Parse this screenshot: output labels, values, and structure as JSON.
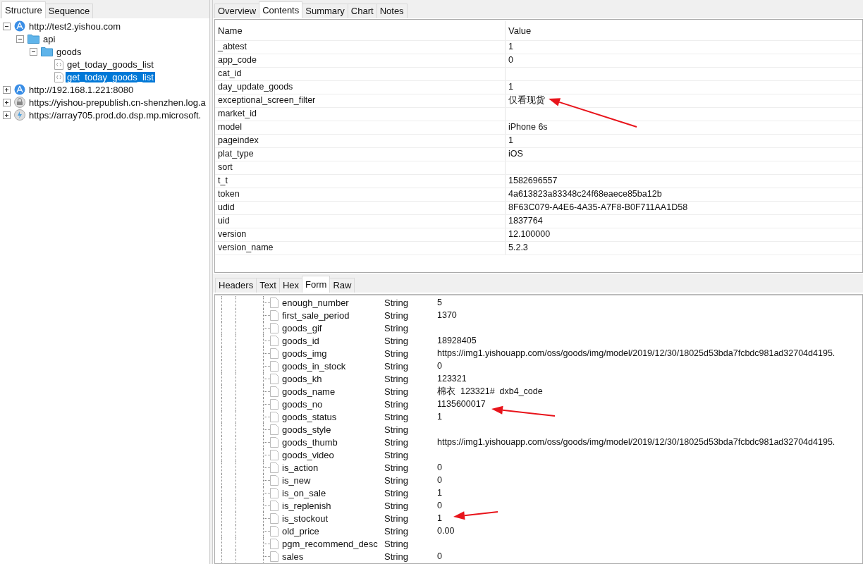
{
  "sidebar": {
    "tabs": [
      {
        "label": "Structure",
        "selected": true
      },
      {
        "label": "Sequence",
        "selected": false
      }
    ],
    "tree": [
      {
        "label": "http://test2.yishou.com",
        "kind": "host",
        "expanded": true,
        "selected": false,
        "children": [
          {
            "label": "api",
            "kind": "folder",
            "expanded": true,
            "selected": false,
            "children": [
              {
                "label": "goods",
                "kind": "folder",
                "expanded": true,
                "selected": false,
                "children": [
                  {
                    "label": "get_today_goods_list",
                    "kind": "request",
                    "selected": false
                  },
                  {
                    "label": "get_today_goods_list",
                    "kind": "request",
                    "selected": true
                  }
                ]
              }
            ]
          }
        ]
      },
      {
        "label": "http://192.168.1.221:8080",
        "kind": "host",
        "expanded": false,
        "selected": false
      },
      {
        "label": "https://yishou-prepublish.cn-shenzhen.log.a",
        "kind": "secure-host",
        "expanded": false,
        "selected": false
      },
      {
        "label": "https://array705.prod.do.dsp.mp.microsoft.",
        "kind": "service-host",
        "expanded": false,
        "selected": false
      }
    ]
  },
  "main": {
    "tabs": [
      {
        "label": "Overview",
        "selected": false
      },
      {
        "label": "Contents",
        "selected": true
      },
      {
        "label": "Summary",
        "selected": false
      },
      {
        "label": "Chart",
        "selected": false
      },
      {
        "label": "Notes",
        "selected": false
      }
    ],
    "table": {
      "columns": [
        "Name",
        "Value"
      ],
      "rows": [
        [
          "_abtest",
          "1"
        ],
        [
          "app_code",
          "0"
        ],
        [
          "cat_id",
          ""
        ],
        [
          "day_update_goods",
          "1"
        ],
        [
          "exceptional_screen_filter",
          "仅看现货"
        ],
        [
          "market_id",
          ""
        ],
        [
          "model",
          "iPhone 6s"
        ],
        [
          "pageindex",
          "1"
        ],
        [
          "plat_type",
          "iOS"
        ],
        [
          "sort",
          ""
        ],
        [
          "t_t",
          "1582696557"
        ],
        [
          "token",
          "4a613823a83348c24f68eaece85ba12b"
        ],
        [
          "udid",
          "8F63C079-A4E6-4A35-A7F8-B0F711AA1D58"
        ],
        [
          "uid",
          "1837764"
        ],
        [
          "version",
          "12.100000"
        ],
        [
          "version_name",
          "5.2.3"
        ]
      ]
    },
    "body_tabs": [
      {
        "label": "Headers",
        "selected": false
      },
      {
        "label": "Text",
        "selected": false
      },
      {
        "label": "Hex",
        "selected": false
      },
      {
        "label": "Form",
        "selected": true
      },
      {
        "label": "Raw",
        "selected": false
      }
    ],
    "form_rows": [
      [
        "enough_number",
        "String",
        "5"
      ],
      [
        "first_sale_period",
        "String",
        "1370"
      ],
      [
        "goods_gif",
        "String",
        ""
      ],
      [
        "goods_id",
        "String",
        "18928405"
      ],
      [
        "goods_img",
        "String",
        "https://img1.yishouapp.com/oss/goods/img/model/2019/12/30/18025d53bda7fcbdc981ad32704d4195."
      ],
      [
        "goods_in_stock",
        "String",
        "0"
      ],
      [
        "goods_kh",
        "String",
        "123321"
      ],
      [
        "goods_name",
        "String",
        "棉衣  123321#  dxb4_code"
      ],
      [
        "goods_no",
        "String",
        "1135600017"
      ],
      [
        "goods_status",
        "String",
        "1"
      ],
      [
        "goods_style",
        "String",
        ""
      ],
      [
        "goods_thumb",
        "String",
        "https://img1.yishouapp.com/oss/goods/img/model/2019/12/30/18025d53bda7fcbdc981ad32704d4195."
      ],
      [
        "goods_video",
        "String",
        ""
      ],
      [
        "is_action",
        "String",
        "0"
      ],
      [
        "is_new",
        "String",
        "0"
      ],
      [
        "is_on_sale",
        "String",
        "1"
      ],
      [
        "is_replenish",
        "String",
        "0"
      ],
      [
        "is_stockout",
        "String",
        "1"
      ],
      [
        "old_price",
        "String",
        "0.00"
      ],
      [
        "pgm_recommend_desc",
        "String",
        ""
      ],
      [
        "sales",
        "String",
        "0"
      ]
    ]
  }
}
